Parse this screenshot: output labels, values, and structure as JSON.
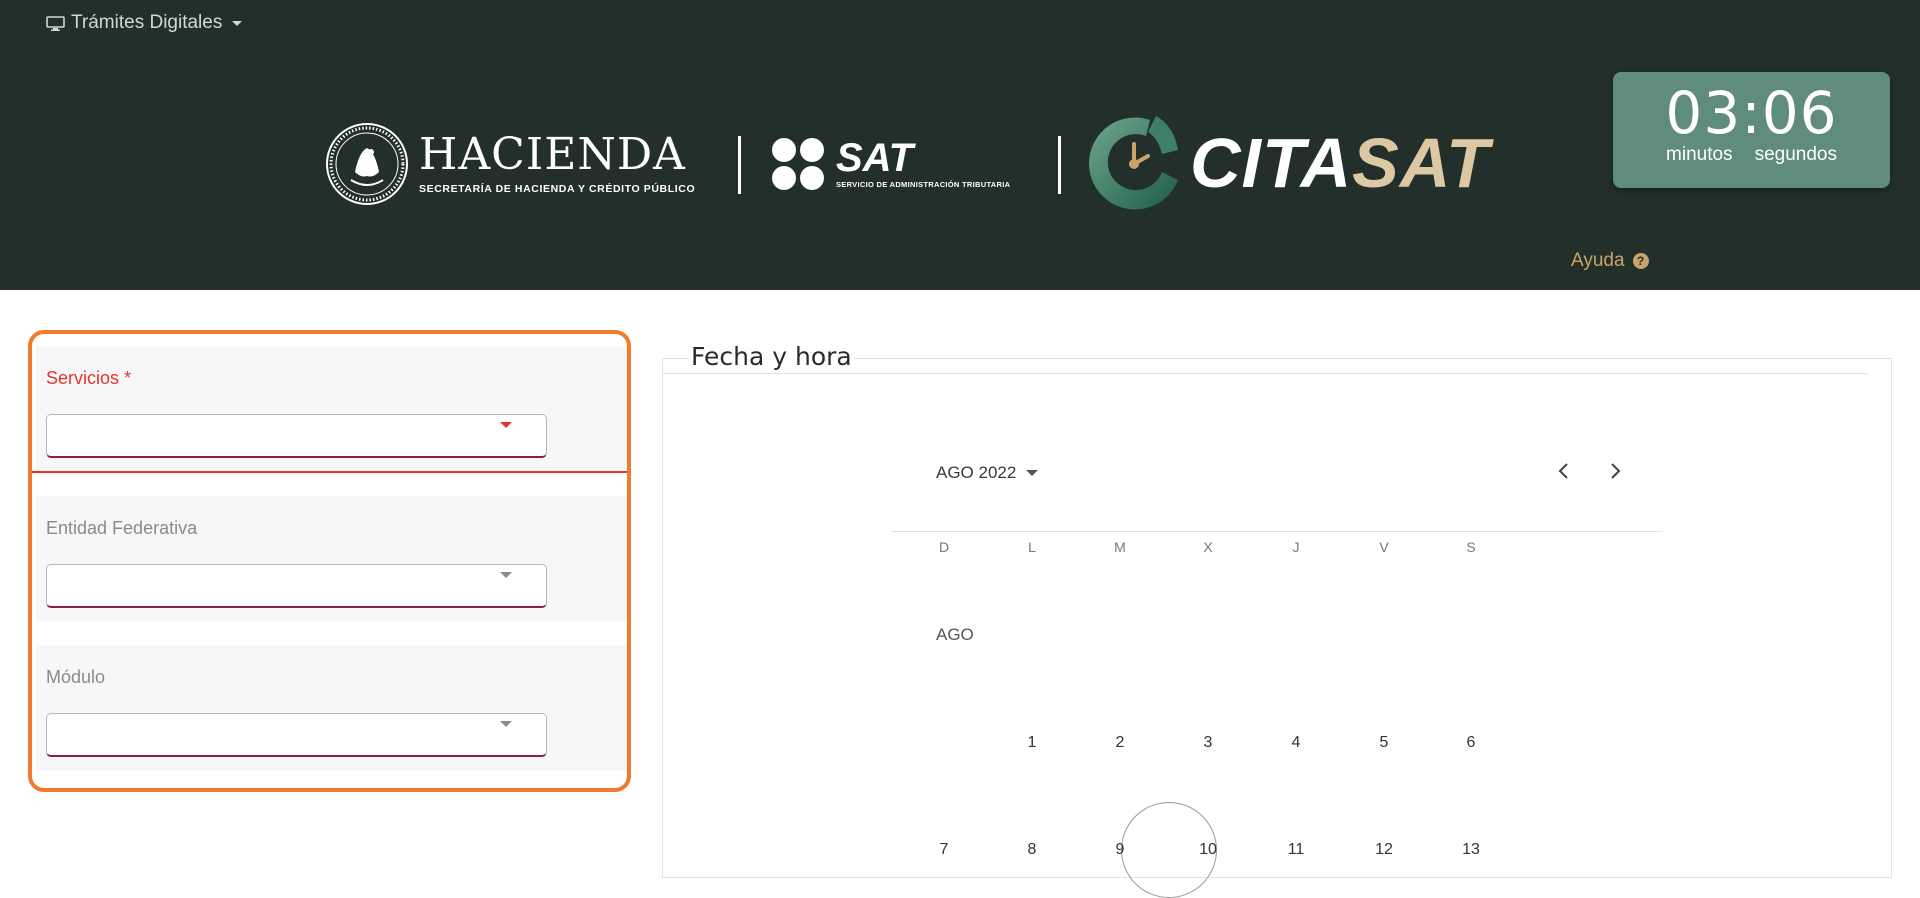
{
  "nav": {
    "menu_label": "Trámites Digitales"
  },
  "logos": {
    "hacienda_title": "HACIENDA",
    "hacienda_subtitle": "SECRETARÍA DE HACIENDA Y CRÉDITO PÚBLICO",
    "sat_title": "SAT",
    "sat_subtitle": "SERVICIO DE ADMINISTRACIÓN TRIBUTARIA",
    "cita_part1": "CITA",
    "cita_part2": "SAT"
  },
  "timer": {
    "value": "03:06",
    "minutes_label": "minutos",
    "seconds_label": "segundos"
  },
  "help": {
    "label": "Ayuda"
  },
  "form": {
    "services_label": "Servicios *",
    "entity_label": "Entidad Federativa",
    "module_label": "Módulo"
  },
  "calendar": {
    "title": "Fecha y hora",
    "month_year": "AGO 2022",
    "month_label": "AGO",
    "weekdays": [
      "D",
      "L",
      "M",
      "X",
      "J",
      "V",
      "S"
    ],
    "week1": [
      "1",
      "2",
      "3",
      "4",
      "5",
      "6"
    ],
    "week2": [
      "7",
      "8",
      "9",
      "10",
      "11",
      "12",
      "13"
    ]
  },
  "colors": {
    "header_bg": "#222f2b",
    "timer_bg": "#5f8c7b",
    "help_gold": "#c9a368",
    "cita_gold": "#dcc9a4",
    "highlight_orange": "#f27a2f",
    "required_red": "#e3342f",
    "input_underline": "#8b1e46"
  }
}
